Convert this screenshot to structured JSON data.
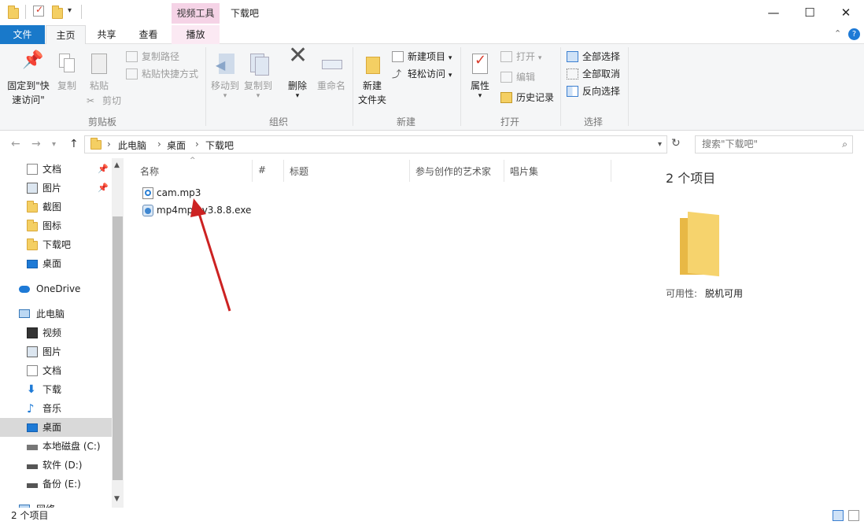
{
  "title_bar": {
    "contextual_tab_group": "视频工具",
    "window_title": "下载吧",
    "minimize": "—",
    "maximize": "☐",
    "close": "✕"
  },
  "menu_tabs": {
    "file": "文件",
    "home": "主页",
    "share": "共享",
    "view": "查看",
    "play": "播放"
  },
  "ribbon": {
    "clipboard": {
      "pin_quick_access_line1": "固定到\"快",
      "pin_quick_access_line2": "速访问\"",
      "copy": "复制",
      "paste": "粘贴",
      "copy_path": "复制路径",
      "paste_shortcut": "粘贴快捷方式",
      "cut": "剪切",
      "label": "剪贴板"
    },
    "organize": {
      "move_to": "移动到",
      "copy_to": "复制到",
      "delete": "删除",
      "rename": "重命名",
      "label": "组织"
    },
    "new": {
      "new_folder_line1": "新建",
      "new_folder_line2": "文件夹",
      "new_item": "新建项目",
      "easy_access": "轻松访问",
      "label": "新建"
    },
    "open": {
      "properties": "属性",
      "open": "打开",
      "edit": "编辑",
      "history": "历史记录",
      "label": "打开"
    },
    "select": {
      "select_all": "全部选择",
      "select_none": "全部取消",
      "invert": "反向选择",
      "label": "选择"
    }
  },
  "address": {
    "crumbs": [
      "此电脑",
      "桌面",
      "下载吧"
    ],
    "search_placeholder": "搜索\"下载吧\""
  },
  "nav": {
    "quick": [
      "文档",
      "图片",
      "截图",
      "图标",
      "下载吧",
      "桌面"
    ],
    "onedrive": "OneDrive",
    "this_pc": "此电脑",
    "pc_items": [
      "视频",
      "图片",
      "文档",
      "下载",
      "音乐",
      "桌面",
      "本地磁盘 (C:)",
      "软件 (D:)",
      "备份 (E:)"
    ],
    "network": "网络"
  },
  "columns": {
    "name": "名称",
    "number": "#",
    "title": "标题",
    "artist": "参与创作的艺术家",
    "album": "唱片集"
  },
  "files": [
    {
      "name": "cam.mp3"
    },
    {
      "name": "mp4mp3 v3.8.8.exe"
    }
  ],
  "details": {
    "count": "2 个项目",
    "availability_label": "可用性:",
    "availability_value": "脱机可用"
  },
  "status": {
    "count": "2 个项目"
  },
  "colors": {
    "file_tab": "#1979ca",
    "context_tab": "#f5d3e6",
    "nav_selected": "#cce8ff",
    "annotation_arrow": "#cc2222",
    "folder": "#f4cf63"
  }
}
